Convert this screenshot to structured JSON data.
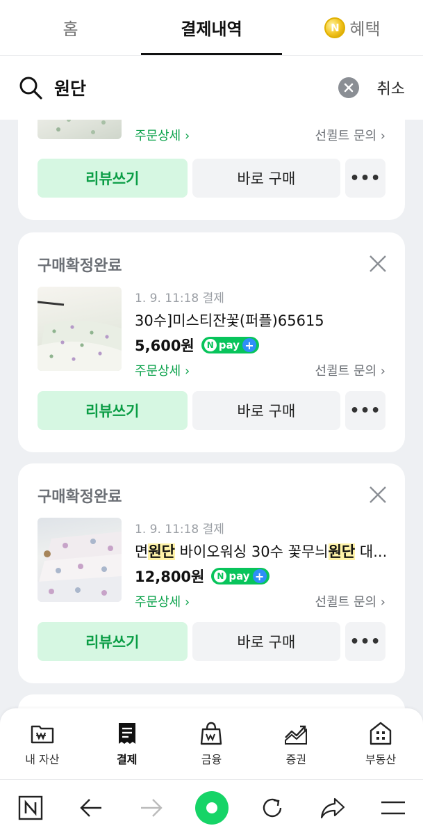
{
  "top_tabs": [
    {
      "label": "홈"
    },
    {
      "label": "결제내역"
    },
    {
      "label": "혜택"
    }
  ],
  "search": {
    "value": "원단",
    "cancel_label": "취소"
  },
  "orders": [
    {
      "order_detail_label": "주문상세",
      "inquiry_label": "선퀼트 문의",
      "review_label": "리뷰쓰기",
      "buy_label": "바로 구매",
      "more_label": "•••"
    },
    {
      "status": "구매확정완료",
      "date": "1. 9. 11:18 결제",
      "title_parts": [
        "30수]미스티잔꽃(퍼플)65615"
      ],
      "price": "5,600원",
      "npay_label": "pay",
      "order_detail_label": "주문상세",
      "inquiry_label": "선퀼트 문의",
      "review_label": "리뷰쓰기",
      "buy_label": "바로 구매",
      "more_label": "•••"
    },
    {
      "status": "구매확정완료",
      "date": "1. 9. 11:18 결제",
      "title_a": "면",
      "title_hl1": "원단",
      "title_b": " 바이오워싱 30수 꽃무늬",
      "title_hl2": "원단",
      "title_c": " 대...",
      "price": "12,800원",
      "npay_label": "pay",
      "order_detail_label": "주문상세",
      "inquiry_label": "선퀼트 문의",
      "review_label": "리뷰쓰기",
      "buy_label": "바로 구매",
      "more_label": "•••"
    }
  ],
  "bottom_nav": [
    {
      "label": "내 자산"
    },
    {
      "label": "결제"
    },
    {
      "label": "금융"
    },
    {
      "label": "증권"
    },
    {
      "label": "부동산"
    }
  ],
  "colors": {
    "accent_green": "#0ba24b",
    "review_bg": "#d6f7e2",
    "highlight": "#fff3a8",
    "npay_green": "#08c45b",
    "browser_green": "#16d467"
  }
}
